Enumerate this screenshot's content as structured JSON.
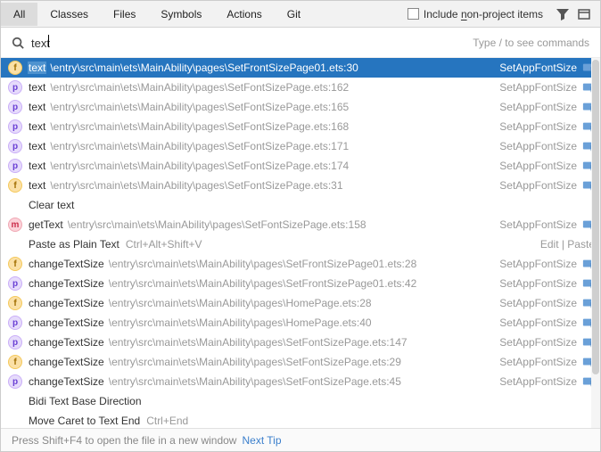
{
  "tabs": {
    "all": "All",
    "classes": "Classes",
    "files": "Files",
    "symbols": "Symbols",
    "actions": "Actions",
    "git": "Git"
  },
  "include": {
    "pre": "Include ",
    "und": "n",
    "post": "on-project items"
  },
  "search": {
    "value": "text",
    "hint": "Type / to see commands"
  },
  "rows": [
    {
      "kind": "f",
      "match": "text",
      "hl": true,
      "path": "\\entry\\src\\main\\ets\\MainAbility\\pages\\SetFrontSizePage01.ets:30",
      "right": "SetAppFontSize",
      "nav": true,
      "selected": true
    },
    {
      "kind": "p",
      "match": "text",
      "hl": false,
      "path": "\\entry\\src\\main\\ets\\MainAbility\\pages\\SetFontSizePage.ets:162",
      "right": "SetAppFontSize",
      "nav": true
    },
    {
      "kind": "p",
      "match": "text",
      "hl": false,
      "path": "\\entry\\src\\main\\ets\\MainAbility\\pages\\SetFontSizePage.ets:165",
      "right": "SetAppFontSize",
      "nav": true
    },
    {
      "kind": "p",
      "match": "text",
      "hl": false,
      "path": "\\entry\\src\\main\\ets\\MainAbility\\pages\\SetFontSizePage.ets:168",
      "right": "SetAppFontSize",
      "nav": true
    },
    {
      "kind": "p",
      "match": "text",
      "hl": false,
      "path": "\\entry\\src\\main\\ets\\MainAbility\\pages\\SetFontSizePage.ets:171",
      "right": "SetAppFontSize",
      "nav": true
    },
    {
      "kind": "p",
      "match": "text",
      "hl": false,
      "path": "\\entry\\src\\main\\ets\\MainAbility\\pages\\SetFontSizePage.ets:174",
      "right": "SetAppFontSize",
      "nav": true
    },
    {
      "kind": "f",
      "match": "text",
      "hl": false,
      "path": "\\entry\\src\\main\\ets\\MainAbility\\pages\\SetFontSizePage.ets:31",
      "right": "SetAppFontSize",
      "nav": true
    },
    {
      "kind": "",
      "match": "Clear text",
      "hl": false,
      "path": "",
      "right": "",
      "nav": false
    },
    {
      "kind": "m",
      "match": "getText",
      "hl": false,
      "path": "\\entry\\src\\main\\ets\\MainAbility\\pages\\SetFontSizePage.ets:158",
      "right": "SetAppFontSize",
      "nav": true
    },
    {
      "kind": "",
      "match": "Paste as Plain Text",
      "shortcut": "Ctrl+Alt+Shift+V",
      "hl": false,
      "path": "",
      "right": "Edit | Paste",
      "nav": false
    },
    {
      "kind": "f",
      "match": "changeTextSize",
      "hl": false,
      "path": "\\entry\\src\\main\\ets\\MainAbility\\pages\\SetFrontSizePage01.ets:28",
      "right": "SetAppFontSize",
      "nav": true
    },
    {
      "kind": "p",
      "match": "changeTextSize",
      "hl": false,
      "path": "\\entry\\src\\main\\ets\\MainAbility\\pages\\SetFrontSizePage01.ets:42",
      "right": "SetAppFontSize",
      "nav": true
    },
    {
      "kind": "f",
      "match": "changeTextSize",
      "hl": false,
      "path": "\\entry\\src\\main\\ets\\MainAbility\\pages\\HomePage.ets:28",
      "right": "SetAppFontSize",
      "nav": true
    },
    {
      "kind": "p",
      "match": "changeTextSize",
      "hl": false,
      "path": "\\entry\\src\\main\\ets\\MainAbility\\pages\\HomePage.ets:40",
      "right": "SetAppFontSize",
      "nav": true
    },
    {
      "kind": "p",
      "match": "changeTextSize",
      "hl": false,
      "path": "\\entry\\src\\main\\ets\\MainAbility\\pages\\SetFontSizePage.ets:147",
      "right": "SetAppFontSize",
      "nav": true
    },
    {
      "kind": "f",
      "match": "changeTextSize",
      "hl": false,
      "path": "\\entry\\src\\main\\ets\\MainAbility\\pages\\SetFontSizePage.ets:29",
      "right": "SetAppFontSize",
      "nav": true
    },
    {
      "kind": "p",
      "match": "changeTextSize",
      "hl": false,
      "path": "\\entry\\src\\main\\ets\\MainAbility\\pages\\SetFontSizePage.ets:45",
      "right": "SetAppFontSize",
      "nav": true
    },
    {
      "kind": "",
      "match": "Bidi Text Base Direction",
      "hl": false,
      "path": "",
      "right": "",
      "nav": false
    },
    {
      "kind": "",
      "match": "Move Caret to Text End",
      "shortcut": "Ctrl+End",
      "hl": false,
      "path": "",
      "right": "",
      "nav": false
    }
  ],
  "footer": {
    "text": "Press Shift+F4 to open the file in a new window",
    "link": "Next Tip"
  }
}
